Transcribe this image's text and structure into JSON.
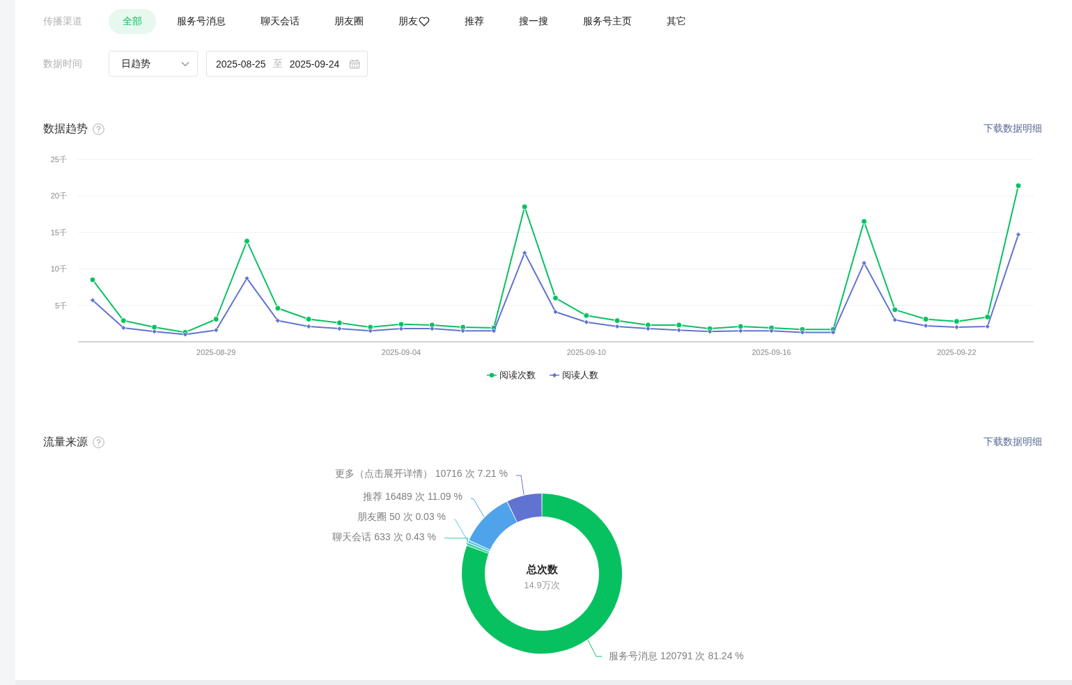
{
  "filters": {
    "channel_label": "传播渠道",
    "channels": [
      {
        "label": "全部",
        "selected": true,
        "kind": "text"
      },
      {
        "label": "服务号消息",
        "selected": false,
        "kind": "text"
      },
      {
        "label": "聊天会话",
        "selected": false,
        "kind": "text"
      },
      {
        "label": "朋友圈",
        "selected": false,
        "kind": "text"
      },
      {
        "label": "朋友",
        "selected": false,
        "kind": "heart"
      },
      {
        "label": "推荐",
        "selected": false,
        "kind": "text"
      },
      {
        "label": "搜一搜",
        "selected": false,
        "kind": "text"
      },
      {
        "label": "服务号主页",
        "selected": false,
        "kind": "text"
      },
      {
        "label": "其它",
        "selected": false,
        "kind": "text"
      }
    ],
    "time_label": "数据时间",
    "granularity": "日趋势",
    "date_from": "2025-08-25",
    "date_separator": "至",
    "date_to": "2025-09-24"
  },
  "trend": {
    "title": "数据趋势",
    "download": "下载数据明细",
    "chart_data": {
      "type": "line",
      "categories": [
        null,
        null,
        null,
        null,
        "2025-08-29",
        null,
        null,
        null,
        null,
        null,
        "2025-09-04",
        null,
        null,
        null,
        null,
        null,
        "2025-09-10",
        null,
        null,
        null,
        null,
        null,
        "2025-09-16",
        null,
        null,
        null,
        null,
        null,
        "2025-09-22",
        null,
        null
      ],
      "series": [
        {
          "name": "阅读次数",
          "color": "#07c160",
          "marker": "circle",
          "values": [
            8.5,
            2.9,
            2.0,
            1.3,
            3.1,
            13.8,
            4.6,
            3.1,
            2.6,
            2.0,
            2.4,
            2.3,
            2.0,
            1.9,
            18.5,
            6.0,
            3.6,
            2.9,
            2.3,
            2.3,
            1.8,
            2.1,
            1.9,
            1.7,
            1.7,
            16.5,
            4.4,
            3.1,
            2.8,
            3.4,
            21.4
          ]
        },
        {
          "name": "阅读人数",
          "color": "#6173d0",
          "marker": "diamond",
          "values": [
            5.7,
            1.9,
            1.4,
            1.0,
            1.6,
            8.7,
            2.9,
            2.1,
            1.8,
            1.5,
            1.8,
            1.8,
            1.5,
            1.5,
            12.2,
            4.1,
            2.7,
            2.1,
            1.8,
            1.6,
            1.4,
            1.5,
            1.5,
            1.3,
            1.3,
            10.8,
            3.0,
            2.2,
            2.0,
            2.1,
            14.7
          ]
        }
      ],
      "ylim": [
        0,
        25
      ],
      "grid": true,
      "yticks": [
        {
          "value": 5,
          "label": "5千"
        },
        {
          "value": 10,
          "label": "10千"
        },
        {
          "value": 15,
          "label": "15千"
        },
        {
          "value": 20,
          "label": "20千"
        },
        {
          "value": 25,
          "label": "25千"
        }
      ]
    }
  },
  "traffic": {
    "title": "流量来源",
    "download": "下载数据明细",
    "center_title": "总次数",
    "center_value": "14.9万次",
    "slice_labels": [
      {
        "text": "更多（点击展开详情） 10716 次 7.21 %",
        "color": "#6173d0"
      },
      {
        "text": "推荐 16489 次 11.09 %",
        "color": "#4ea3ea"
      },
      {
        "text": "朋友圈 50 次 0.03 %",
        "color": "#52c7e6"
      },
      {
        "text": "聊天会话 633 次 0.43 %",
        "color": "#3cc6a0"
      },
      {
        "text": "服务号消息 120791 次 81.24 %",
        "color": "#07c160"
      }
    ],
    "chart_data": {
      "type": "donut",
      "series": [
        {
          "values": [
            7.21,
            11.09,
            0.03,
            0.43,
            81.24
          ]
        }
      ]
    }
  }
}
